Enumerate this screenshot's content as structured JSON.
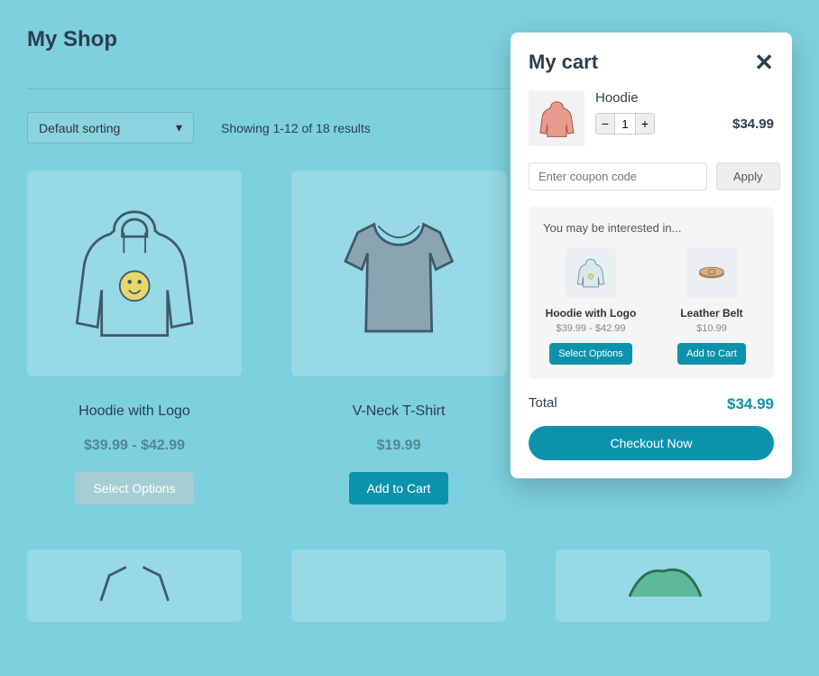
{
  "shop": {
    "title": "My Shop",
    "sort_label": "Default sorting",
    "results_text": "Showing 1-12 of 18 results",
    "products": [
      {
        "name": "Hoodie with Logo",
        "price": "$39.99 - $42.99",
        "button": "Select Options",
        "btn_style": "muted"
      },
      {
        "name": "V-Neck T-Shirt",
        "price": "$19.99",
        "button": "Add to Cart",
        "btn_style": "teal"
      },
      {
        "name": "",
        "price": "",
        "button": "",
        "btn_style": ""
      }
    ]
  },
  "cart": {
    "title": "My cart",
    "item": {
      "name": "Hoodie",
      "qty": "1",
      "price": "$34.99"
    },
    "coupon_placeholder": "Enter coupon code",
    "apply_label": "Apply",
    "suggest_title": "You may be interested in...",
    "suggestions": [
      {
        "name": "Hoodie with Logo",
        "price": "$39.99 - $42.99",
        "button": "Select Options"
      },
      {
        "name": "Leather Belt",
        "price": "$10.99",
        "button": "Add to Cart"
      }
    ],
    "total_label": "Total",
    "total_value": "$34.99",
    "checkout_label": "Checkout Now"
  }
}
